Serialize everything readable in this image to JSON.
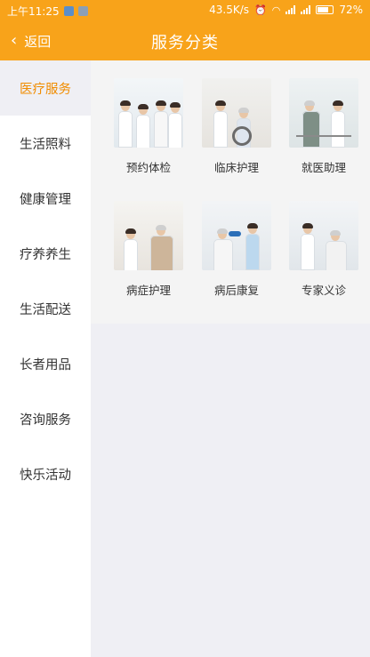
{
  "status_bar": {
    "time": "上午11:25",
    "network_speed": "43.5K/s",
    "battery": "72%"
  },
  "title_bar": {
    "back_label": "返回",
    "title": "服务分类"
  },
  "sidebar": {
    "items": [
      {
        "label": "医疗服务",
        "active": true
      },
      {
        "label": "生活照料",
        "active": false
      },
      {
        "label": "健康管理",
        "active": false
      },
      {
        "label": "疗养养生",
        "active": false
      },
      {
        "label": "生活配送",
        "active": false
      },
      {
        "label": "长者用品",
        "active": false
      },
      {
        "label": "咨询服务",
        "active": false
      },
      {
        "label": "快乐活动",
        "active": false
      }
    ]
  },
  "services": {
    "items": [
      {
        "label": "预约体检"
      },
      {
        "label": "临床护理"
      },
      {
        "label": "就医助理"
      },
      {
        "label": "病症护理"
      },
      {
        "label": "病后康复"
      },
      {
        "label": "专家义诊"
      }
    ]
  },
  "colors": {
    "brand": "#f8a31a",
    "active_text": "#f08c00",
    "background": "#efeff4"
  },
  "icons": {
    "back": "chevron-left-icon",
    "wifi": "wifi-icon",
    "alarm": "alarm-icon",
    "battery": "battery-icon",
    "signal": "signal-icon"
  }
}
